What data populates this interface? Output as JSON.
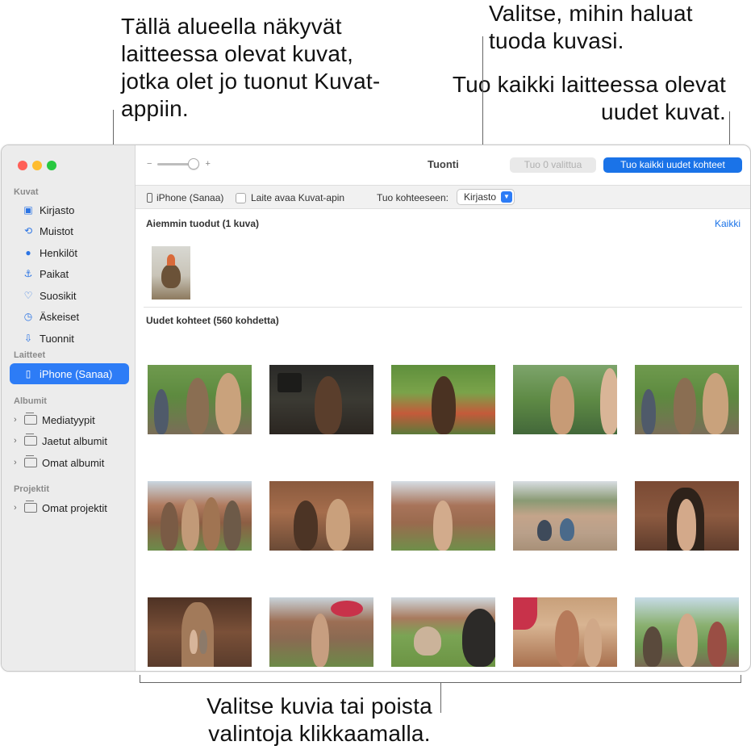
{
  "callouts": {
    "top_left": "Tällä alueella näkyvät laitteessa olevat kuvat, jotka olet jo tuonut Kuvat-appiin.",
    "top_right_1": "Valitse, mihin haluat tuoda kuvasi.",
    "top_right_2": "Tuo kaikki laitteessa olevat uudet kuvat.",
    "bottom": "Valitse kuvia tai poista valintoja klikkaamalla."
  },
  "sidebar": {
    "sections": {
      "kuvat": "Kuvat",
      "laitteet": "Laitteet",
      "albumit": "Albumit",
      "projektit": "Projektit"
    },
    "library_items": [
      {
        "label": "Kirjasto",
        "icon": "photo-library-icon"
      },
      {
        "label": "Muistot",
        "icon": "memories-icon"
      },
      {
        "label": "Henkilöt",
        "icon": "people-icon"
      },
      {
        "label": "Paikat",
        "icon": "places-pin-icon"
      },
      {
        "label": "Suosikit",
        "icon": "heart-icon"
      },
      {
        "label": "Äskeiset",
        "icon": "clock-icon"
      },
      {
        "label": "Tuonnit",
        "icon": "import-icon"
      }
    ],
    "device": {
      "label": "iPhone (Sanaa)",
      "icon": "iphone-icon"
    },
    "album_items": [
      "Mediatyypit",
      "Jaetut albumit",
      "Omat albumit"
    ],
    "project_items": [
      "Omat projektit"
    ]
  },
  "toolbar": {
    "zoom_minus": "−",
    "zoom_plus": "+",
    "title": "Tuonti",
    "import_selected": "Tuo 0 valittua",
    "import_all": "Tuo kaikki uudet kohteet"
  },
  "options": {
    "device_name": "iPhone (Sanaa)",
    "auto_open_label": "Laite avaa Kuvat-apin",
    "import_to_label": "Tuo kohteeseen:",
    "import_to_value": "Kirjasto"
  },
  "content": {
    "previous_title": "Aiemmin tuodut (1 kuva)",
    "all_link": "Kaikki",
    "new_title": "Uudet kohteet (560 kohdetta)"
  },
  "colors": {
    "accent": "#1a73e8",
    "sidebar_selected": "#2d7cf6"
  }
}
